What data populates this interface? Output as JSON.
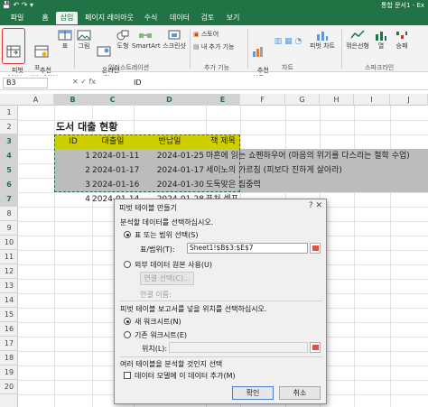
{
  "window": {
    "quick_access": "💾 ↶ ↷ ▾",
    "doc_title": "통합 문서1 - Ex"
  },
  "tabs": [
    "파일",
    "홈",
    "삽입",
    "페이지 레이아웃",
    "수식",
    "데이터",
    "검토",
    "보기"
  ],
  "active_tab": "삽입",
  "ribbon": {
    "buttons": [
      {
        "label": "피벗\n테이블"
      },
      {
        "label": "추천\n피벗 테이블"
      },
      {
        "label": "표"
      },
      {
        "label": "그림"
      },
      {
        "label": "온라인\n그림"
      },
      {
        "label": "도형"
      },
      {
        "label": "SmartArt"
      },
      {
        "label": "스크린샷"
      },
      {
        "label": "스토어"
      },
      {
        "label": "내 추가 기능"
      },
      {
        "label": "추천\n차트"
      },
      {
        "label": "피벗 차트"
      },
      {
        "label": "꺾은선형"
      },
      {
        "label": "열"
      },
      {
        "label": "승패"
      }
    ],
    "groups": [
      "표",
      "일러스트레이션",
      "추가 기능",
      "차트",
      "스파크라인"
    ]
  },
  "formula_bar": {
    "name_box": "B3",
    "icons": "✕  ✓  fx",
    "value": "ID"
  },
  "columns": [
    "A",
    "B",
    "C",
    "D",
    "E",
    "F",
    "G",
    "H",
    "I",
    "J"
  ],
  "rows": [
    "1",
    "2",
    "3",
    "4",
    "5",
    "6",
    "7",
    "8",
    "9",
    "10",
    "11",
    "12",
    "13",
    "14",
    "15",
    "16",
    "17",
    "18",
    "19",
    "20"
  ],
  "sheet": {
    "title": "도서 대출 현황",
    "headers": [
      "ID",
      "대출일",
      "반납일",
      "책 제목"
    ],
    "data": [
      [
        "1",
        "2024-01-11",
        "2024-01-25",
        "마흔에 읽는 쇼펜하우어 (마음의 위기를 다스리는 철학 수업)"
      ],
      [
        "2",
        "2024-01-17",
        "2024-01-17",
        "세이노의 가르침 (피보다 진하게 살아라)"
      ],
      [
        "3",
        "2024-01-16",
        "2024-01-30",
        "도둑맞은 집중력"
      ],
      [
        "4",
        "2024-01-14",
        "2024-01-28",
        "퓨처 셀프"
      ]
    ]
  },
  "dialog": {
    "title": "피벗 테이블 만들기",
    "close": "?  ✕",
    "section1": "분석할 데이터를 선택하십시오.",
    "opt_range": "표 또는 범위 선택(S)",
    "range_label": "표/범위(T):",
    "range_value": "Sheet1!$B$3:$E$7",
    "opt_external": "외부 데이터 원본 사용(U)",
    "conn_button": "연결 선택(C)...",
    "conn_name": "연결 이름:",
    "section2": "피벗 테이블 보고서를 넣을 위치를 선택하십시오.",
    "opt_new": "새 워크시트(N)",
    "opt_existing": "기존 워크시트(E)",
    "location_label": "위치(L):",
    "section3": "여러 테이블을 분석할 것인지 선택",
    "add_model": "데이터 모델에 이 데이터 추가(M)",
    "ok": "확인",
    "cancel": "취소"
  }
}
